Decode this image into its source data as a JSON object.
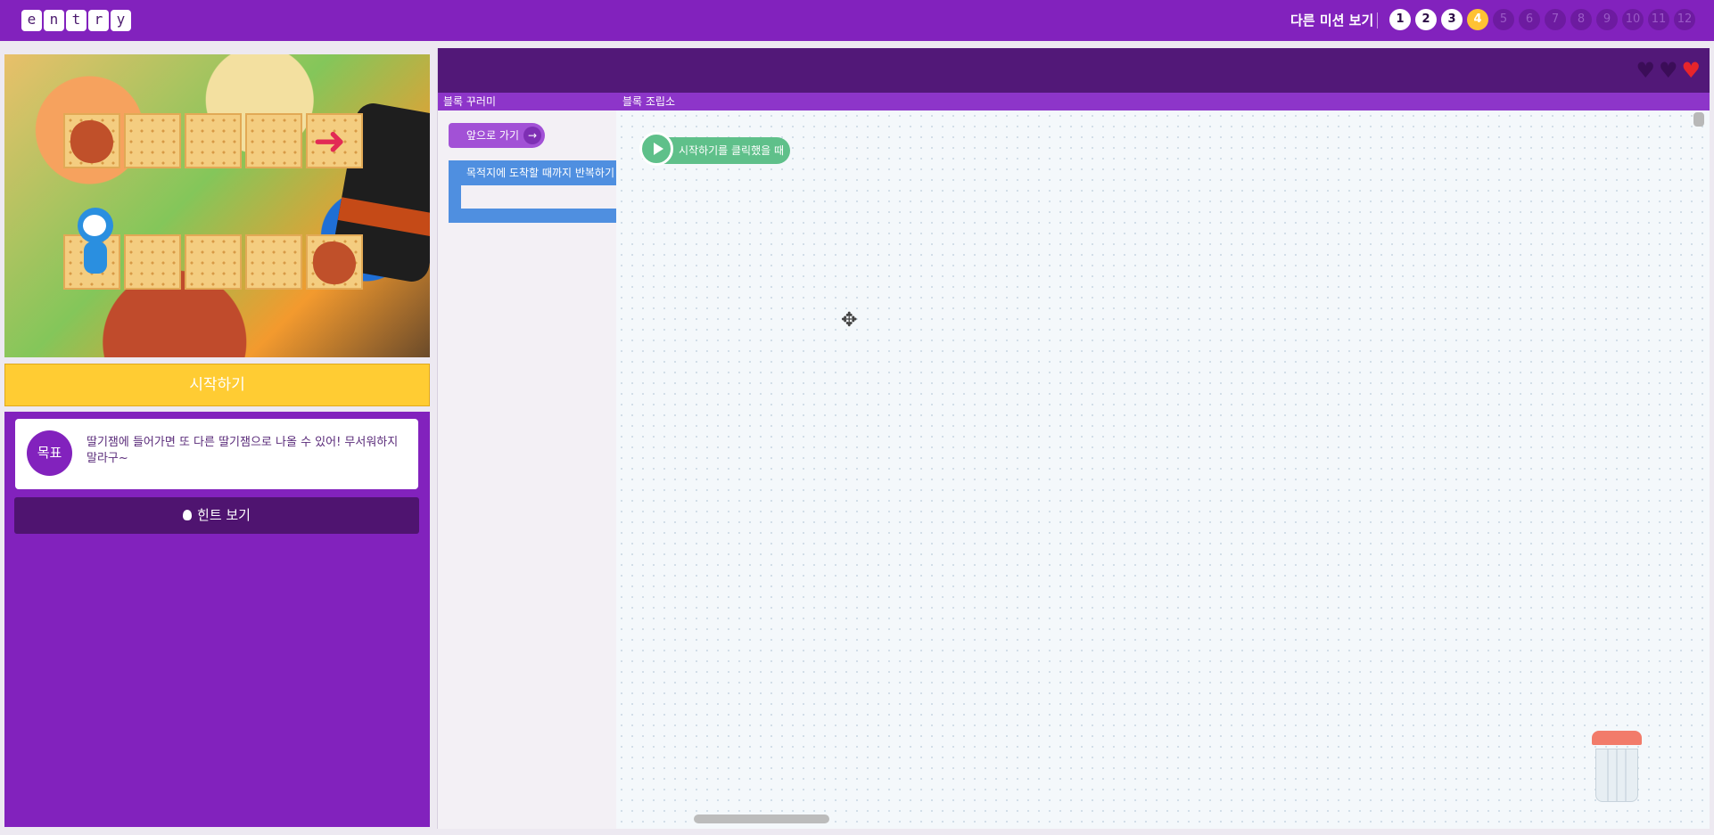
{
  "header": {
    "logo_letters": [
      "e",
      "n",
      "t",
      "r",
      "y"
    ],
    "other_missions_label": "다른 미션 보기",
    "stages": [
      {
        "label": "1",
        "state": "done"
      },
      {
        "label": "2",
        "state": "done"
      },
      {
        "label": "3",
        "state": "done"
      },
      {
        "label": "4",
        "state": "current"
      },
      {
        "label": "5",
        "state": "locked"
      },
      {
        "label": "6",
        "state": "locked"
      },
      {
        "label": "7",
        "state": "locked"
      },
      {
        "label": "8",
        "state": "locked"
      },
      {
        "label": "9",
        "state": "locked"
      },
      {
        "label": "10",
        "state": "locked"
      },
      {
        "label": "11",
        "state": "locked"
      },
      {
        "label": "12",
        "state": "locked"
      }
    ],
    "colors": {
      "bar": "#8222bd",
      "current_stage": "#ffc233"
    }
  },
  "left_panel": {
    "start_button_label": "시작하기",
    "goal_badge": "목표",
    "goal_text": "딸기잼에 들어가면 또 다른 딸기잼으로 나올 수 있어! 무서워하지 말라구~",
    "hint_button_label": "힌트 보기"
  },
  "workspace": {
    "lives": [
      {
        "name": "heart-empty",
        "color": "#3b0d58"
      },
      {
        "name": "heart-empty",
        "color": "#3b0d58"
      },
      {
        "name": "heart-full",
        "color": "#e8252b"
      }
    ],
    "palette_label": "블록 꾸러미",
    "assembly_label": "블록 조립소",
    "palette_blocks": {
      "move_forward": "앞으로 가기",
      "repeat_until": "목적지에 도착할 때까지 반복하기"
    },
    "start_block_label": "시작하기를 클릭했을 때"
  }
}
